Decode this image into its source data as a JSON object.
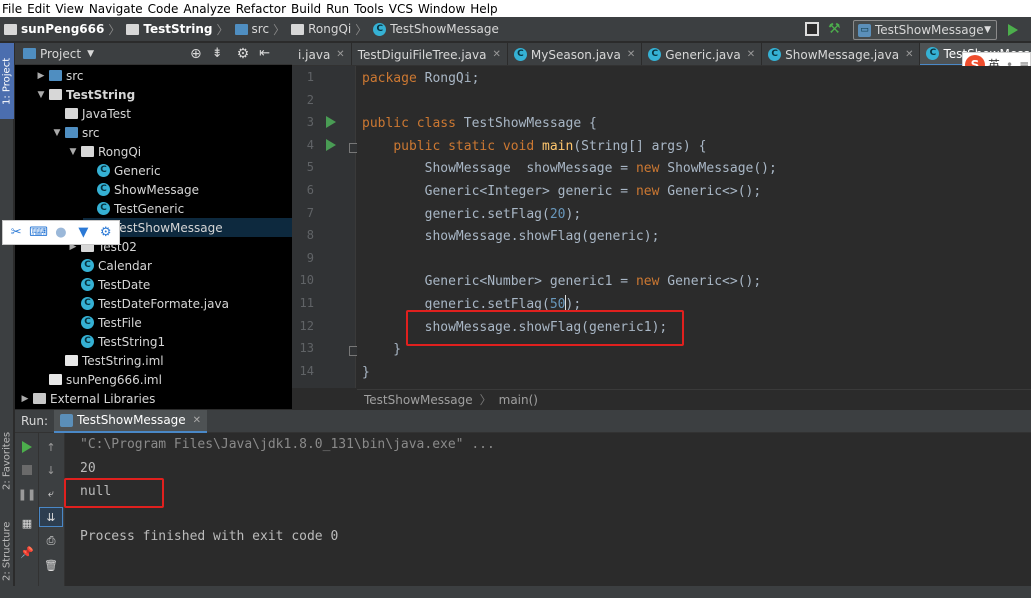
{
  "menu": [
    "File",
    "Edit",
    "View",
    "Navigate",
    "Code",
    "Analyze",
    "Refactor",
    "Build",
    "Run",
    "Tools",
    "VCS",
    "Window",
    "Help"
  ],
  "breadcrumbs": [
    "sunPeng666",
    "TestString",
    "src",
    "RongQi",
    "TestShowMessage"
  ],
  "run_config": "TestShowMessage",
  "stripe": {
    "project": "1: Project",
    "favorites": "2: Favorites",
    "structure": "2: Structure"
  },
  "project_panel": {
    "title": "Project"
  },
  "tree": [
    {
      "label": "src",
      "icon": "folder-blue-icon",
      "depth": 1,
      "expand": "collapsed"
    },
    {
      "label": "TestString",
      "icon": "module-icon",
      "depth": 1,
      "expand": "expanded",
      "bold": true
    },
    {
      "label": "JavaTest",
      "icon": "folder-icon",
      "depth": 2,
      "expand": "none"
    },
    {
      "label": "src",
      "icon": "folder-blue-icon",
      "depth": 2,
      "expand": "expanded"
    },
    {
      "label": "RongQi",
      "icon": "package-icon",
      "depth": 3,
      "expand": "expanded"
    },
    {
      "label": "Generic",
      "icon": "class-icon",
      "depth": 4,
      "expand": "none"
    },
    {
      "label": "ShowMessage",
      "icon": "class-icon",
      "depth": 4,
      "expand": "none"
    },
    {
      "label": "TestGeneric",
      "icon": "class-icon",
      "depth": 4,
      "expand": "none"
    },
    {
      "label": "TestShowMessage",
      "icon": "class-icon",
      "depth": 4,
      "expand": "none",
      "selected": true
    },
    {
      "label": "Test02",
      "icon": "package-icon",
      "depth": 3,
      "expand": "collapsed"
    },
    {
      "label": "Calendar",
      "icon": "class-icon",
      "depth": 3,
      "expand": "none"
    },
    {
      "label": "TestDate",
      "icon": "class-icon",
      "depth": 3,
      "expand": "none"
    },
    {
      "label": "TestDateFormate.java",
      "icon": "class-icon",
      "depth": 3,
      "expand": "none"
    },
    {
      "label": "TestFile",
      "icon": "class-icon",
      "depth": 3,
      "expand": "none"
    },
    {
      "label": "TestString1",
      "icon": "class-icon",
      "depth": 3,
      "expand": "none"
    },
    {
      "label": "TestString.iml",
      "icon": "file-icon",
      "depth": 2,
      "expand": "none"
    },
    {
      "label": "sunPeng666.iml",
      "icon": "file-icon",
      "depth": 1,
      "expand": "none"
    },
    {
      "label": "External Libraries",
      "icon": "library-icon",
      "depth": 0,
      "expand": "collapsed"
    }
  ],
  "editor_tabs": [
    {
      "label": "i.java",
      "active": false,
      "icon": false
    },
    {
      "label": "TestDiguiFileTree.java",
      "active": false,
      "icon": false
    },
    {
      "label": "MySeason.java",
      "active": false,
      "icon": true
    },
    {
      "label": "Generic.java",
      "active": false,
      "icon": true
    },
    {
      "label": "ShowMessage.java",
      "active": false,
      "icon": true
    },
    {
      "label": "TestShowMessage.java",
      "active": true,
      "icon": true
    }
  ],
  "line_numbers": [
    "1",
    "2",
    "3",
    "4",
    "5",
    "6",
    "7",
    "8",
    "9",
    "10",
    "11",
    "12",
    "13",
    "14"
  ],
  "code_lines": [
    [
      [
        "kw",
        "package "
      ],
      [
        "t",
        "RongQi;"
      ]
    ],
    [],
    [
      [
        "kw",
        "public class "
      ],
      [
        "t",
        "TestShowMessage {"
      ]
    ],
    [
      [
        "t",
        "    "
      ],
      [
        "kw",
        "public static void "
      ],
      [
        "fn",
        "main"
      ],
      [
        "t",
        "(String[] args) {"
      ]
    ],
    [
      [
        "t",
        "        ShowMessage  showMessage = "
      ],
      [
        "kw",
        "new "
      ],
      [
        "t",
        "ShowMessage();"
      ]
    ],
    [
      [
        "t",
        "        Generic<Integer> generic = "
      ],
      [
        "kw",
        "new "
      ],
      [
        "t",
        "Generic<>();"
      ]
    ],
    [
      [
        "t",
        "        generic.setFlag("
      ],
      [
        "num",
        "20"
      ],
      [
        "t",
        ");"
      ]
    ],
    [
      [
        "t",
        "        showMessage.showFlag(generic);"
      ]
    ],
    [],
    [
      [
        "t",
        "        Generic<Number> generic1 = "
      ],
      [
        "kw",
        "new "
      ],
      [
        "t",
        "Generic<>();"
      ]
    ],
    [
      [
        "t",
        "        generic.setFlag("
      ],
      [
        "num",
        "50"
      ],
      [
        "t",
        ");"
      ]
    ],
    [
      [
        "t",
        "        showMessage.showFlag(generic1);"
      ]
    ],
    [
      [
        "t",
        "    }"
      ]
    ],
    [
      [
        "t",
        "}"
      ]
    ]
  ],
  "editor_breadcrumb": [
    "TestShowMessage",
    "main()"
  ],
  "run": {
    "label": "Run:",
    "tab": "TestShowMessage"
  },
  "console_lines": [
    "\"C:\\Program Files\\Java\\jdk1.8.0_131\\bin\\java.exe\" ...",
    "20",
    "null",
    "",
    "Process finished with exit code 0"
  ],
  "ime": {
    "label": "英"
  }
}
